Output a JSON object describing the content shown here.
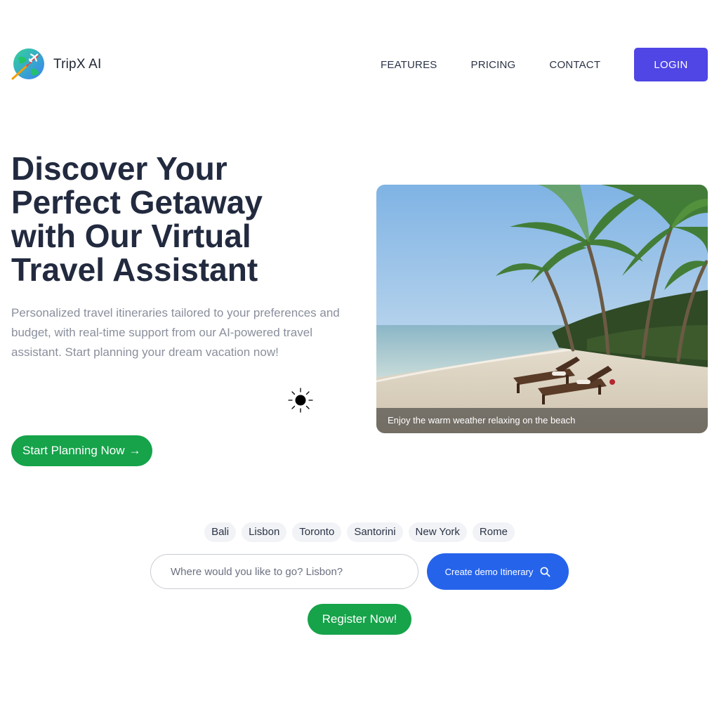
{
  "brand": {
    "name": "TripX AI",
    "logo_icon": "globe-plane-icon"
  },
  "nav": {
    "items": [
      {
        "label": "FEATURES"
      },
      {
        "label": "PRICING"
      },
      {
        "label": "CONTACT"
      }
    ],
    "login_label": "LOGIN"
  },
  "hero": {
    "title": "Discover Your Perfect Getaway with Our Virtual Travel Assistant",
    "subtitle": "Personalized travel itineraries tailored to your preferences and budget, with real-time support from our AI-powered travel assistant. Start planning your dream vacation now!",
    "theme_icon": "sun-icon",
    "cta_label": "Start Planning Now",
    "cta_arrow": "→"
  },
  "image_card": {
    "caption": "Enjoy the warm weather relaxing on the beach"
  },
  "destinations": [
    "Bali",
    "Lisbon",
    "Toronto",
    "Santorini",
    "New York",
    "Rome"
  ],
  "search": {
    "placeholder": "Where would you like to go? Lisbon?",
    "value": "",
    "button_label": "Create demo Itinerary",
    "button_icon": "search-icon"
  },
  "register": {
    "label": "Register Now!"
  },
  "colors": {
    "primary_indigo": "#4f46e5",
    "blue": "#2563eb",
    "green": "#16a34a",
    "heading": "#222a3f",
    "muted": "#8a8f9c"
  }
}
